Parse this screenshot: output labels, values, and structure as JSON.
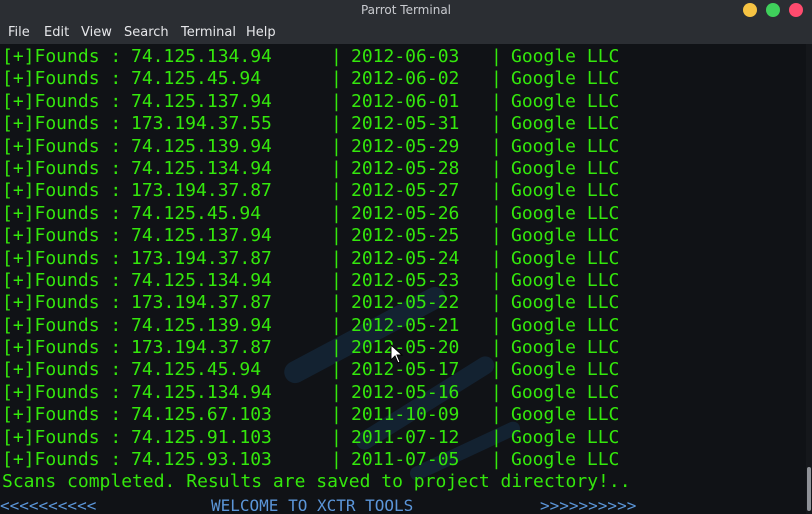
{
  "window": {
    "title": "Parrot Terminal",
    "menu": [
      "File",
      "Edit",
      "View",
      "Search",
      "Terminal",
      "Help"
    ]
  },
  "terminal": {
    "colors": {
      "text": "#34e80c",
      "banner": "#5b95d8",
      "background": "#101216"
    },
    "rows": [
      {
        "prefix": "[+]Founds :",
        "ip": "74.125.134.94",
        "sep1": "|",
        "date": "2012-06-03",
        "sep2": "|",
        "org": "Google LLC"
      },
      {
        "prefix": "[+]Founds :",
        "ip": "74.125.45.94",
        "sep1": "|",
        "date": "2012-06-02",
        "sep2": "|",
        "org": "Google LLC"
      },
      {
        "prefix": "[+]Founds :",
        "ip": "74.125.137.94",
        "sep1": "|",
        "date": "2012-06-01",
        "sep2": "|",
        "org": "Google LLC"
      },
      {
        "prefix": "[+]Founds :",
        "ip": "173.194.37.55",
        "sep1": "|",
        "date": "2012-05-31",
        "sep2": "|",
        "org": "Google LLC"
      },
      {
        "prefix": "[+]Founds :",
        "ip": "74.125.139.94",
        "sep1": "|",
        "date": "2012-05-29",
        "sep2": "|",
        "org": "Google LLC"
      },
      {
        "prefix": "[+]Founds :",
        "ip": "74.125.134.94",
        "sep1": "|",
        "date": "2012-05-28",
        "sep2": "|",
        "org": "Google LLC"
      },
      {
        "prefix": "[+]Founds :",
        "ip": "173.194.37.87",
        "sep1": "|",
        "date": "2012-05-27",
        "sep2": "|",
        "org": "Google LLC"
      },
      {
        "prefix": "[+]Founds :",
        "ip": "74.125.45.94",
        "sep1": "|",
        "date": "2012-05-26",
        "sep2": "|",
        "org": "Google LLC"
      },
      {
        "prefix": "[+]Founds :",
        "ip": "74.125.137.94",
        "sep1": "|",
        "date": "2012-05-25",
        "sep2": "|",
        "org": "Google LLC"
      },
      {
        "prefix": "[+]Founds :",
        "ip": "173.194.37.87",
        "sep1": "|",
        "date": "2012-05-24",
        "sep2": "|",
        "org": "Google LLC"
      },
      {
        "prefix": "[+]Founds :",
        "ip": "74.125.134.94",
        "sep1": "|",
        "date": "2012-05-23",
        "sep2": "|",
        "org": "Google LLC"
      },
      {
        "prefix": "[+]Founds :",
        "ip": "173.194.37.87",
        "sep1": "|",
        "date": "2012-05-22",
        "sep2": "|",
        "org": "Google LLC"
      },
      {
        "prefix": "[+]Founds :",
        "ip": "74.125.139.94",
        "sep1": "|",
        "date": "2012-05-21",
        "sep2": "|",
        "org": "Google LLC"
      },
      {
        "prefix": "[+]Founds :",
        "ip": "173.194.37.87",
        "sep1": "|",
        "date": "2012-05-20",
        "sep2": "|",
        "org": "Google LLC"
      },
      {
        "prefix": "[+]Founds :",
        "ip": "74.125.45.94",
        "sep1": "|",
        "date": "2012-05-17",
        "sep2": "|",
        "org": "Google LLC"
      },
      {
        "prefix": "[+]Founds :",
        "ip": "74.125.134.94",
        "sep1": "|",
        "date": "2012-05-16",
        "sep2": "|",
        "org": "Google LLC"
      },
      {
        "prefix": "[+]Founds :",
        "ip": "74.125.67.103",
        "sep1": "|",
        "date": "2011-10-09",
        "sep2": "|",
        "org": "Google LLC"
      },
      {
        "prefix": "[+]Founds :",
        "ip": "74.125.91.103",
        "sep1": "|",
        "date": "2011-07-12",
        "sep2": "|",
        "org": "Google LLC"
      },
      {
        "prefix": "[+]Founds :",
        "ip": "74.125.93.103",
        "sep1": "|",
        "date": "2011-07-05",
        "sep2": "|",
        "org": "Google LLC"
      }
    ],
    "status": "Scans completed. Results are saved to project directory!..",
    "banner": {
      "left": "<<<<<<<<<<",
      "center": "WELCOME TO XCTR TOOLS",
      "right": ">>>>>>>>>>"
    }
  }
}
